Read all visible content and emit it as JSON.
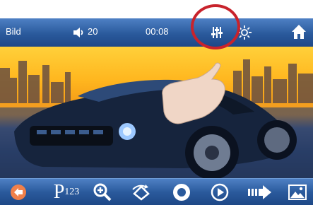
{
  "topbar": {
    "title": "Bild",
    "volume": "20",
    "time": "00:08",
    "icons": [
      "volume-icon",
      "equalizer-icon",
      "brightness-icon",
      "home-icon"
    ]
  },
  "bottombar": {
    "page_label": "P",
    "page_number": "123",
    "icons": [
      "back-icon",
      "zoom-in-icon",
      "rotate-icon",
      "stop-icon",
      "play-icon",
      "next-icon",
      "gallery-icon"
    ]
  },
  "colors": {
    "bar_blue": "#2a5a9c",
    "icon_white": "#ffffff",
    "back_orange": "#f0804a",
    "highlight_ring": "#c8232c"
  }
}
